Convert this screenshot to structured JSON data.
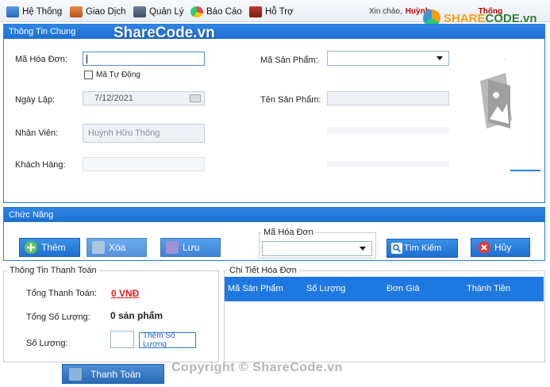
{
  "menu": {
    "items": [
      {
        "label": "Hệ Thống",
        "icon": "system-icon"
      },
      {
        "label": "Giao Dịch",
        "icon": "transaction-icon"
      },
      {
        "label": "Quản Lý",
        "icon": "manage-icon"
      },
      {
        "label": "Báo Cáo",
        "icon": "report-icon"
      },
      {
        "label": "Hỗ Trợ",
        "icon": "support-icon"
      }
    ],
    "greeting": "Xin chào,",
    "user_name": "Huỳnh",
    "user_name_tail": "Thống"
  },
  "logo": {
    "part1": "SHARE",
    "part2": "CODE.vn"
  },
  "general": {
    "title": "Thông Tin Chung",
    "watermark": "ShareCode.vn",
    "invoice_id_label": "Mã Hóa Đơn:",
    "invoice_id_value": "",
    "auto_id_label": "Mã Tự Động",
    "date_label": "Ngày Lập:",
    "date_value": "7/12/2021",
    "employee_label": "Nhân Viên:",
    "employee_value": "Huỳnh Hữu Thống",
    "customer_label": "Khách Hàng:",
    "product_id_label": "Mã Sản Phẩm:",
    "product_name_label": "Tên Sản Phẩm:",
    "product_name_value": ""
  },
  "functions": {
    "title": "Chức Năng",
    "add_label": "Thêm",
    "delete_label": "Xóa",
    "save_label": "Lưu",
    "search_group_label": "Mã Hóa Đơn",
    "search_label": "Tìm Kiếm",
    "cancel_label": "Hủy"
  },
  "payment": {
    "title": "Thông Tin Thanh Toán",
    "total_label": "Tổng Thanh Toán:",
    "total_value": "0 VNĐ",
    "qty_total_label": "Tổng Số Lượng:",
    "qty_total_value": "0 sản phẩm",
    "qty_label": "Số Lượng:",
    "qty_value": "",
    "add_qty_label": "Thêm Số Lượng",
    "checkout_label": "Thanh Toán"
  },
  "detail": {
    "title": "Chi Tiết Hóa Đơn",
    "columns": [
      "Mã Sản Phẩm",
      "Số Lượng",
      "Đơn Giá",
      "Thành Tiền"
    ]
  },
  "footer_watermark": "Copyright © ShareCode.vn",
  "colors": {
    "accent": "#1c6fd1",
    "total": "#e02020"
  }
}
